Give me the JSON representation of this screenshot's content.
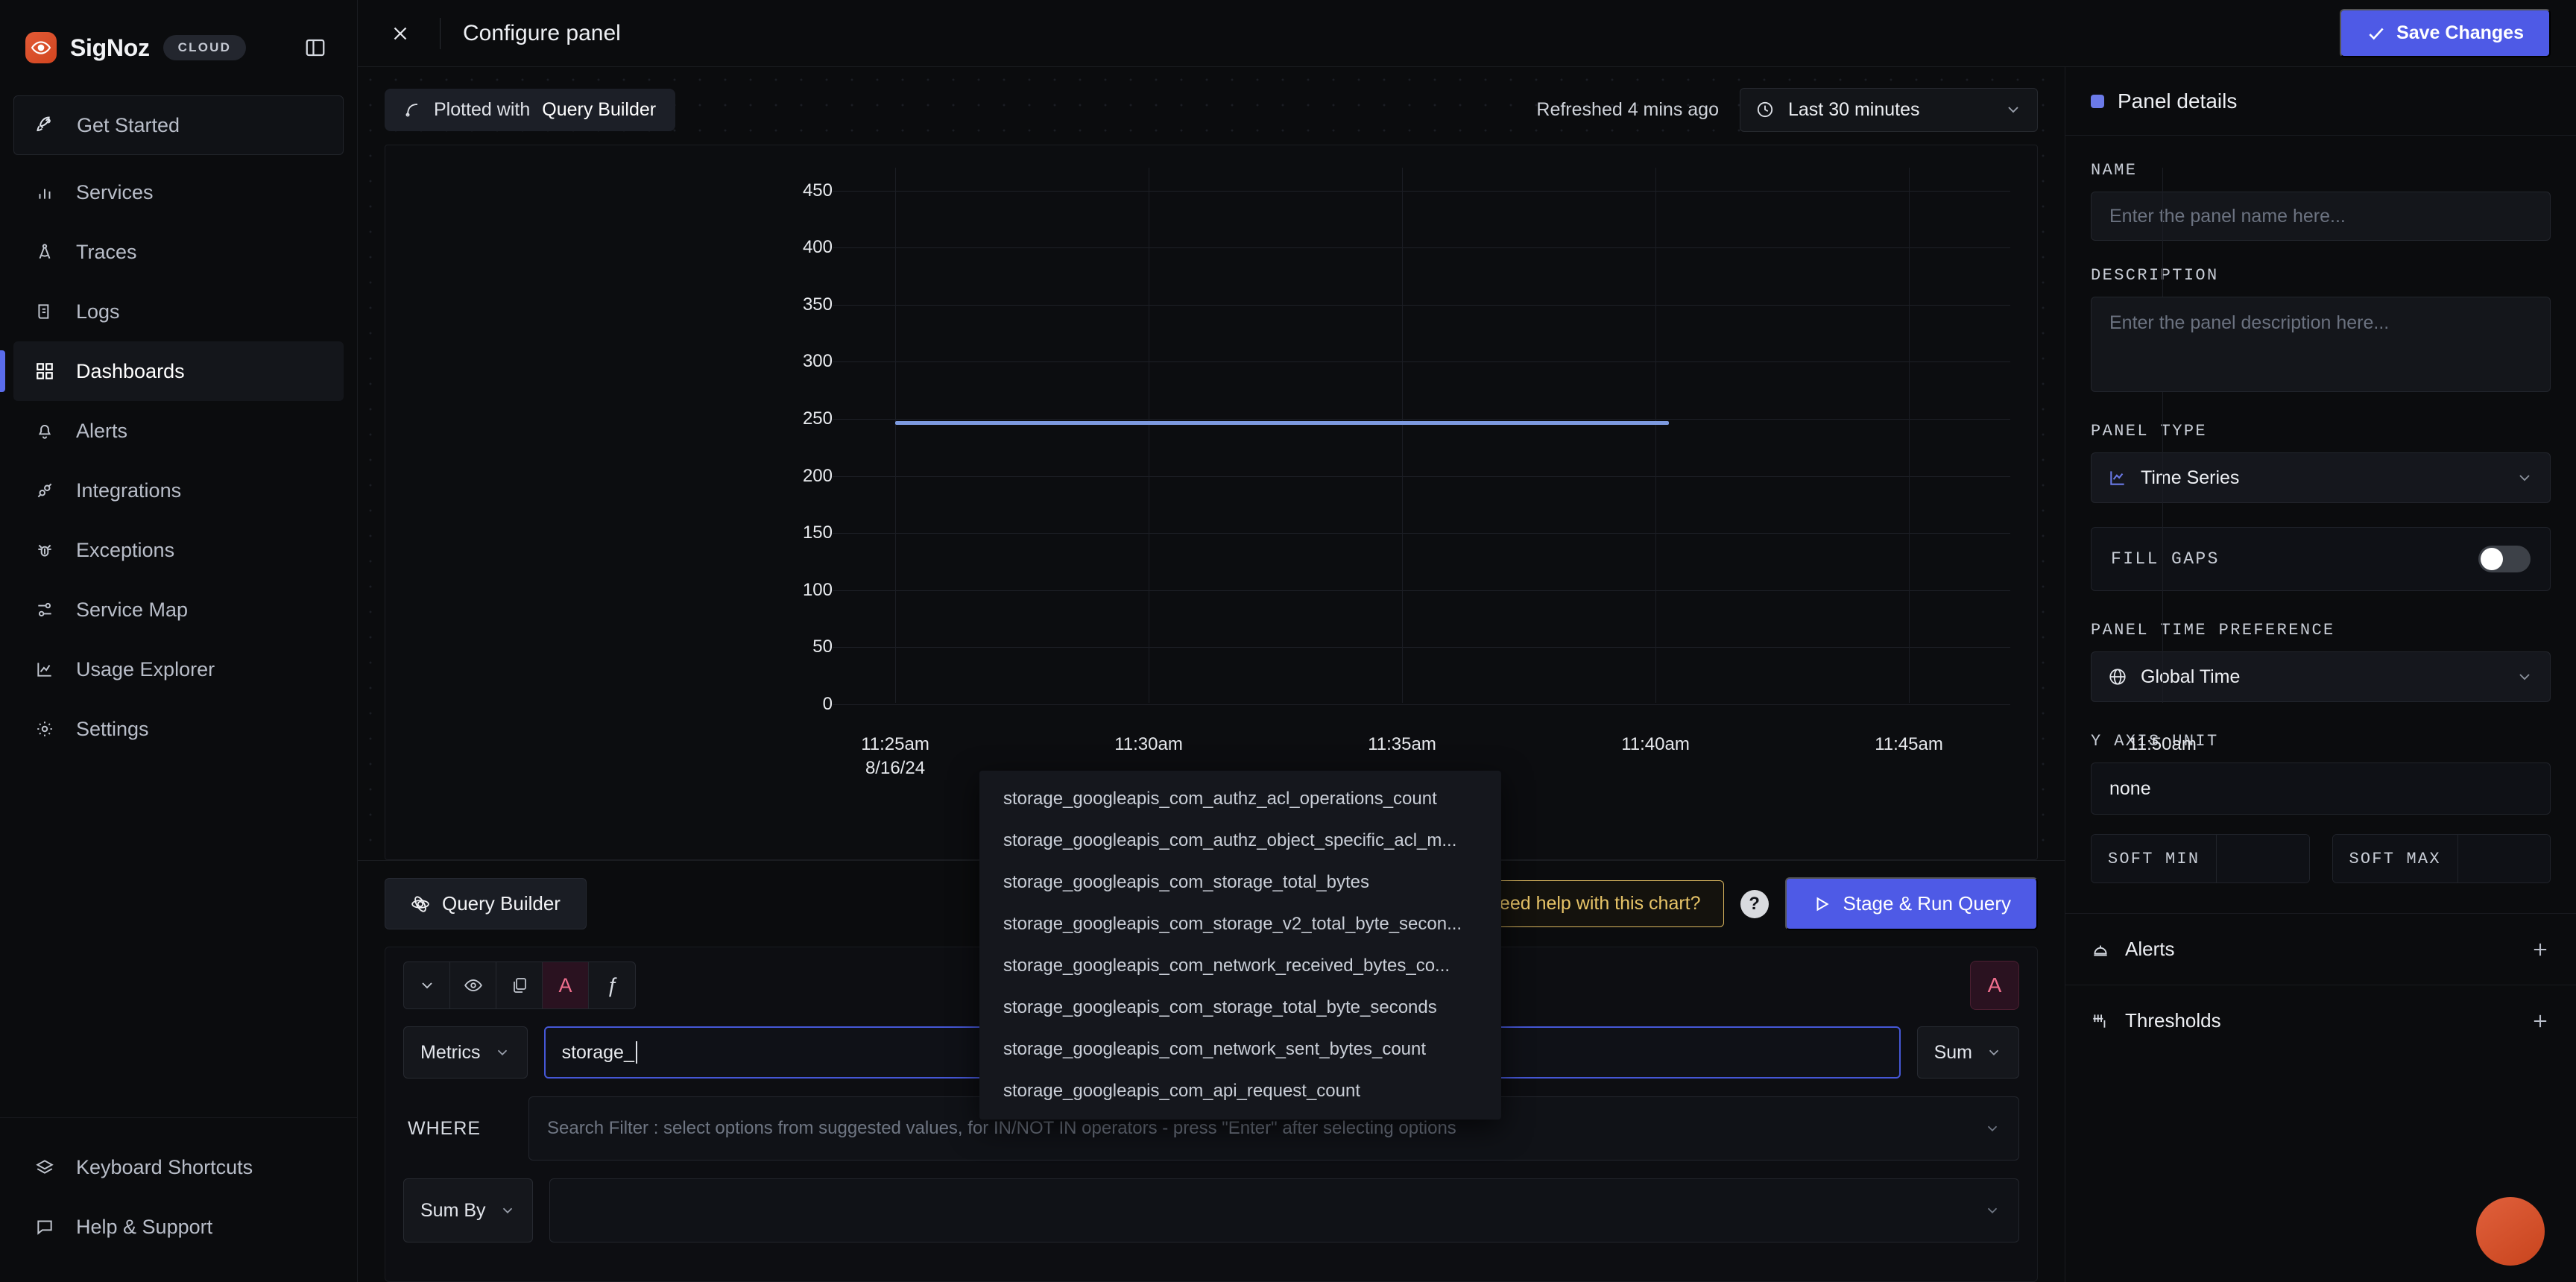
{
  "brand": {
    "name": "SigNoz",
    "badge": "CLOUD"
  },
  "sidebar": {
    "items": [
      {
        "label": "Get Started",
        "icon": "rocket-icon"
      },
      {
        "label": "Services",
        "icon": "bar-chart-icon"
      },
      {
        "label": "Traces",
        "icon": "compass-icon"
      },
      {
        "label": "Logs",
        "icon": "scroll-icon"
      },
      {
        "label": "Dashboards",
        "icon": "grid-icon"
      },
      {
        "label": "Alerts",
        "icon": "bell-icon"
      },
      {
        "label": "Integrations",
        "icon": "plug-icon"
      },
      {
        "label": "Exceptions",
        "icon": "bug-icon"
      },
      {
        "label": "Service Map",
        "icon": "nodes-icon"
      },
      {
        "label": "Usage Explorer",
        "icon": "area-chart-icon"
      },
      {
        "label": "Settings",
        "icon": "gear-icon"
      }
    ],
    "bottom_items": [
      {
        "label": "Keyboard Shortcuts",
        "icon": "layers-icon"
      },
      {
        "label": "Help & Support",
        "icon": "message-icon"
      }
    ]
  },
  "topbar": {
    "title": "Configure panel",
    "close_icon": "close-icon",
    "save_label": "Save Changes"
  },
  "chart_toolbar": {
    "plotted_prefix": "Plotted with",
    "plotted_source": "Query Builder",
    "refreshed": "Refreshed 4 mins ago",
    "time_range": "Last 30 minutes",
    "clock_icon": "clock-icon"
  },
  "chart_data": {
    "type": "line",
    "title": "",
    "xlabel": "",
    "ylabel": "",
    "ylim": [
      0,
      470
    ],
    "yticks": [
      0,
      50,
      100,
      150,
      200,
      250,
      300,
      350,
      400,
      450
    ],
    "xticks": [
      "11:25am",
      "11:30am",
      "11:35am",
      "11:40am",
      "11:45am",
      "11:50am"
    ],
    "x_date_label": "8/16/24",
    "grid": true,
    "legend_position": "bottom",
    "series": [
      {
        "name": "A",
        "color": "#7d9ae0",
        "x": [
          "11:30am",
          "11:31am",
          "11:35am",
          "11:38am",
          "11:40am"
        ],
        "values": [
          248,
          248,
          248,
          248,
          248
        ]
      }
    ]
  },
  "autocomplete": {
    "options": [
      "storage_googleapis_com_authz_acl_operations_count",
      "storage_googleapis_com_authz_object_specific_acl_m...",
      "storage_googleapis_com_storage_total_bytes",
      "storage_googleapis_com_storage_v2_total_byte_secon...",
      "storage_googleapis_com_network_received_bytes_co...",
      "storage_googleapis_com_storage_total_byte_seconds",
      "storage_googleapis_com_network_sent_bytes_count",
      "storage_googleapis_com_api_request_count"
    ]
  },
  "query_bar": {
    "tab_label": "Query Builder",
    "tab_icon": "atom-icon",
    "help_label": "Need help with this chart?",
    "help_icon": "question-circle-icon",
    "question_icon": "question-mark-icon",
    "run_label": "Stage & Run Query",
    "run_icon": "play-icon"
  },
  "query_editor": {
    "icons": [
      "chevron-down-icon",
      "eye-icon",
      "copy-icon",
      "letter-a-icon",
      "fx-icon"
    ],
    "query_badge": "A",
    "fx_label": "ƒ",
    "source_label": "Metrics",
    "metric_value": "storage_",
    "aggregate_label": "Sum",
    "where_label": "WHERE",
    "where_placeholder": "Search Filter : select options from suggested values, for IN/NOT IN operators - press \"Enter\" after selecting options",
    "groupby_label": "Sum By",
    "groupby_value": ""
  },
  "panel_details": {
    "header": "Panel details",
    "name_label": "NAME",
    "name_placeholder": "Enter the panel name here...",
    "description_label": "DESCRIPTION",
    "description_placeholder": "Enter the panel description here...",
    "panel_type_label": "PANEL TYPE",
    "panel_type_value": "Time Series",
    "panel_type_icon": "line-chart-icon",
    "fill_gaps_label": "FILL GAPS",
    "fill_gaps_on": false,
    "time_preference_label": "PANEL TIME PREFERENCE",
    "time_preference_value": "Global Time",
    "time_preference_icon": "globe-icon",
    "y_axis_unit_label": "Y AXIS UNIT",
    "y_axis_unit_value": "none",
    "soft_min_label": "SOFT MIN",
    "soft_min_value": "",
    "soft_max_label": "SOFT MAX",
    "soft_max_value": "",
    "alerts_label": "Alerts",
    "alerts_icon": "bell-alert-icon",
    "thresholds_label": "Thresholds",
    "thresholds_icon": "thresholds-icon",
    "add_icon": "plus-icon"
  },
  "colors": {
    "accent_blue": "#4e5ae6",
    "series_blue": "#7d9ae0",
    "brand_orange": "#d2451f",
    "warning_yellow": "#d7b45e",
    "query_pink": "#ef6f8e"
  }
}
